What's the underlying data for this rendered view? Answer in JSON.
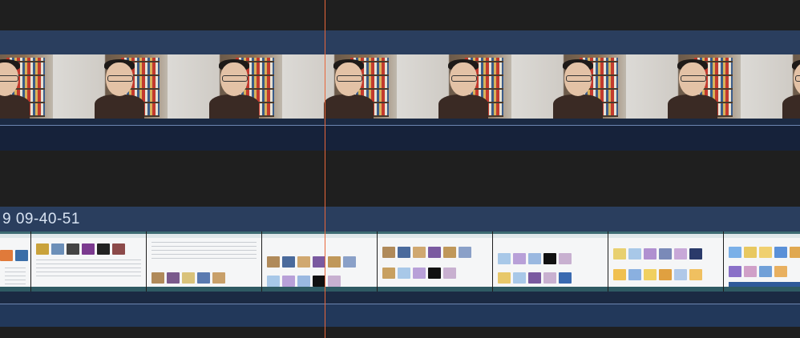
{
  "timeline": {
    "video_clip": {
      "type": "camera",
      "frame_count": 7
    },
    "screen_clip": {
      "title": "9 09-40-51",
      "frame_count": 7
    },
    "colors": {
      "background": "#1e1e1e",
      "clip_header": "#2a3e5e",
      "clip_body": "#1b2a43",
      "playhead": "#e8663a"
    }
  }
}
